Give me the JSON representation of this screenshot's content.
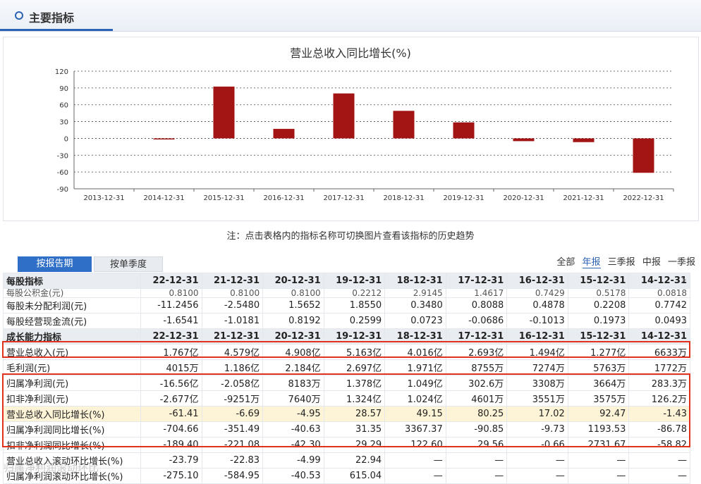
{
  "header": {
    "title": "主要指标"
  },
  "chart_data": {
    "type": "bar",
    "title": "营业总收入同比增长(%)",
    "categories": [
      "2013-12-31",
      "2014-12-31",
      "2015-12-31",
      "2016-12-31",
      "2017-12-31",
      "2018-12-31",
      "2019-12-31",
      "2020-12-31",
      "2021-12-31",
      "2022-12-31"
    ],
    "values": [
      null,
      -1.43,
      92.47,
      17.02,
      80.25,
      49.15,
      28.57,
      -4.95,
      -6.69,
      -61.41
    ],
    "ylim": [
      -90,
      120
    ],
    "yticks": [
      120,
      90,
      60,
      30,
      0,
      -30,
      -60,
      -90
    ],
    "grid": true,
    "bar_color": "#a31515"
  },
  "note": "注：点击表格内的指标名称可切换图片查看该指标的历史趋势",
  "tabs": [
    "按报告期",
    "按单季度"
  ],
  "filters": [
    "全部",
    "年报",
    "三季报",
    "中报",
    "一季报"
  ],
  "filters_active": 1,
  "columns": [
    "22-12-31",
    "21-12-31",
    "20-12-31",
    "19-12-31",
    "18-12-31",
    "17-12-31",
    "16-12-31",
    "15-12-31",
    "14-12-31"
  ],
  "table": {
    "sec1": "每股指标",
    "clip_row": {
      "name": "每股公积金(元)",
      "cells": [
        "0.8100",
        "0.8100",
        "0.8100",
        "0.2212",
        "2.9145",
        "1.4617",
        "0.7429",
        "0.5178",
        "0.0818"
      ]
    },
    "rows1": [
      {
        "name": "每股未分配利润(元)",
        "cells": [
          "-11.2456",
          "-2.5480",
          "1.5652",
          "1.8550",
          "0.3480",
          "0.8088",
          "0.4878",
          "0.2208",
          "0.7742"
        ]
      },
      {
        "name": "每股经营现金流(元)",
        "cells": [
          "-1.6541",
          "-1.0181",
          "0.8192",
          "0.2599",
          "0.0723",
          "-0.0686",
          "-0.1013",
          "0.1973",
          "0.0493"
        ]
      }
    ],
    "sec2": "成长能力指标",
    "rows2": [
      {
        "name": "营业总收入(元)",
        "cells": [
          "1.767亿",
          "4.579亿",
          "4.908亿",
          "5.163亿",
          "4.016亿",
          "2.693亿",
          "1.494亿",
          "1.277亿",
          "6633万"
        ]
      },
      {
        "name": "毛利润(元)",
        "cells": [
          "4015万",
          "1.186亿",
          "2.184亿",
          "2.697亿",
          "1.971亿",
          "8755万",
          "7274万",
          "5763万",
          "1772万"
        ]
      },
      {
        "name": "归属净利润(元)",
        "cells": [
          "-16.56亿",
          "-2.058亿",
          "8183万",
          "1.378亿",
          "1.049亿",
          "302.6万",
          "3308万",
          "3664万",
          "283.3万"
        ]
      },
      {
        "name": "扣非净利润(元)",
        "cells": [
          "-2.677亿",
          "-9251万",
          "7640万",
          "1.324亿",
          "1.024亿",
          "4601万",
          "3551万",
          "3575万",
          "126.2万"
        ]
      },
      {
        "name": "营业总收入同比增长(%)",
        "cells": [
          "-61.41",
          "-6.69",
          "-4.95",
          "28.57",
          "49.15",
          "80.25",
          "17.02",
          "92.47",
          "-1.43"
        ],
        "highlight": true
      },
      {
        "name": "归属净利润同比增长(%)",
        "cells": [
          "-704.66",
          "-351.49",
          "-40.63",
          "31.35",
          "3367.37",
          "-90.85",
          "-9.73",
          "1193.53",
          "-86.78"
        ]
      },
      {
        "name": "扣非净利润同比增长(%)",
        "cells": [
          "-189.40",
          "-221.08",
          "-42.30",
          "29.29",
          "122.60",
          "29.56",
          "-0.66",
          "2731.67",
          "-58.82"
        ]
      },
      {
        "name": "营业总收入滚动环比增长(%)",
        "cells": [
          "-23.79",
          "-22.83",
          "-4.99",
          "22.94",
          "—",
          "—",
          "—",
          "—",
          "—"
        ]
      },
      {
        "name": "归属净利润滚动环比增长(%)",
        "cells": [
          "-275.10",
          "-584.95",
          "-40.53",
          "615.04",
          "—",
          "—",
          "—",
          "—",
          "—"
        ]
      }
    ]
  }
}
